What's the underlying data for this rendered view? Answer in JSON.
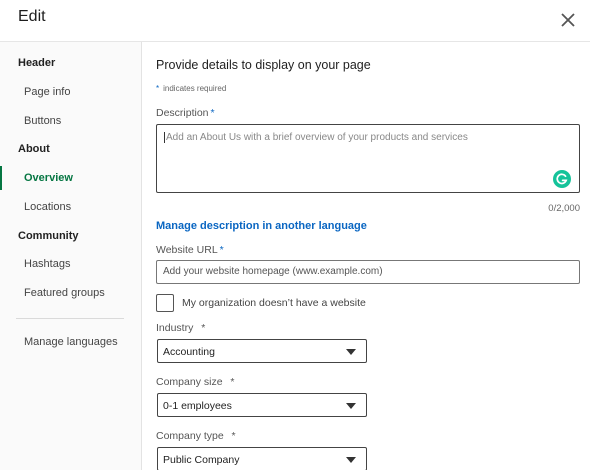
{
  "modal": {
    "title": "Edit",
    "close_icon": "close-icon"
  },
  "sidebar": {
    "sections": [
      {
        "label": "Header"
      },
      {
        "label": "About"
      },
      {
        "label": "Community"
      }
    ],
    "items": [
      {
        "label": "Page info"
      },
      {
        "label": "Buttons"
      },
      {
        "label": "Overview",
        "active": true
      },
      {
        "label": "Locations"
      },
      {
        "label": "Hashtags"
      },
      {
        "label": "Featured groups"
      },
      {
        "label": "Manage languages"
      }
    ],
    "active_color": "#057642"
  },
  "form": {
    "heading": "Provide details to display on your page",
    "required_star": "*",
    "required_note": "indicates required",
    "description": {
      "label": "Description",
      "star": "*",
      "placeholder": "Add an About Us with a brief overview of your products and services",
      "counter": "0/2,000",
      "grammarly_icon": "grammarly-icon"
    },
    "manage_language_link": "Manage description in another language",
    "website": {
      "label": "Website URL",
      "star": "*",
      "placeholder": "Add your website homepage (www.example.com)"
    },
    "no_website_checkbox": {
      "label": "My organization doesn’t have a website",
      "checked": false
    },
    "industry": {
      "label": "Industry",
      "star": "*",
      "value": "Accounting"
    },
    "company_size": {
      "label": "Company size",
      "star": "*",
      "value": "0-1 employees"
    },
    "company_type": {
      "label": "Company type",
      "star": "*",
      "value": "Public Company"
    }
  },
  "colors": {
    "link": "#0a66c2",
    "grammarly": "#15c39a"
  }
}
